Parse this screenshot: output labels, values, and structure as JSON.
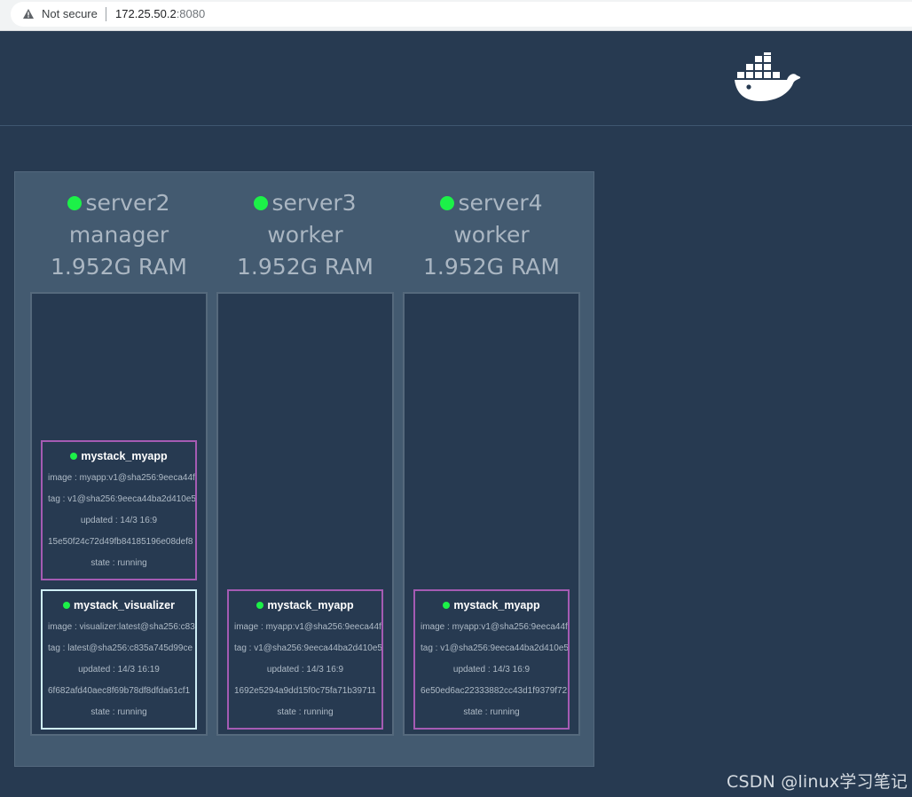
{
  "browser": {
    "security_label": "Not secure",
    "url_host": "172.25.50.2",
    "url_port": ":8080"
  },
  "header": {
    "logo_icon": "docker-whale-icon"
  },
  "nodes": [
    {
      "name": "server2",
      "role": "manager",
      "ram": "1.952G RAM",
      "status_color": "#1cf148",
      "tasks": [
        {
          "name": "mystack_myapp",
          "image": "image : myapp:v1@sha256:9eeca44f",
          "tag": "tag : v1@sha256:9eeca44ba2d410e5",
          "updated": "updated : 14/3 16:9",
          "id": "15e50f24c72d49fb84185196e08def8",
          "state": "state : running"
        },
        {
          "name": "mystack_visualizer",
          "image": "image : visualizer:latest@sha256:c83",
          "tag": "tag : latest@sha256:c835a745d99ce",
          "updated": "updated : 14/3 16:19",
          "id": "6f682afd40aec8f69b78df8dfda61cf1",
          "state": "state : running"
        }
      ]
    },
    {
      "name": "server3",
      "role": "worker",
      "ram": "1.952G RAM",
      "status_color": "#1cf148",
      "tasks": [
        {
          "name": "mystack_myapp",
          "image": "image : myapp:v1@sha256:9eeca44f",
          "tag": "tag : v1@sha256:9eeca44ba2d410e5",
          "updated": "updated : 14/3 16:9",
          "id": "1692e5294a9dd15f0c75fa71b39711",
          "state": "state : running"
        }
      ]
    },
    {
      "name": "server4",
      "role": "worker",
      "ram": "1.952G RAM",
      "status_color": "#1cf148",
      "tasks": [
        {
          "name": "mystack_myapp",
          "image": "image : myapp:v1@sha256:9eeca44f",
          "tag": "tag : v1@sha256:9eeca44ba2d410e5",
          "updated": "updated : 14/3 16:9",
          "id": "6e50ed6ac22333882cc43d1f9379f72",
          "state": "state : running"
        }
      ]
    }
  ],
  "watermark": "CSDN @linux学习笔记"
}
